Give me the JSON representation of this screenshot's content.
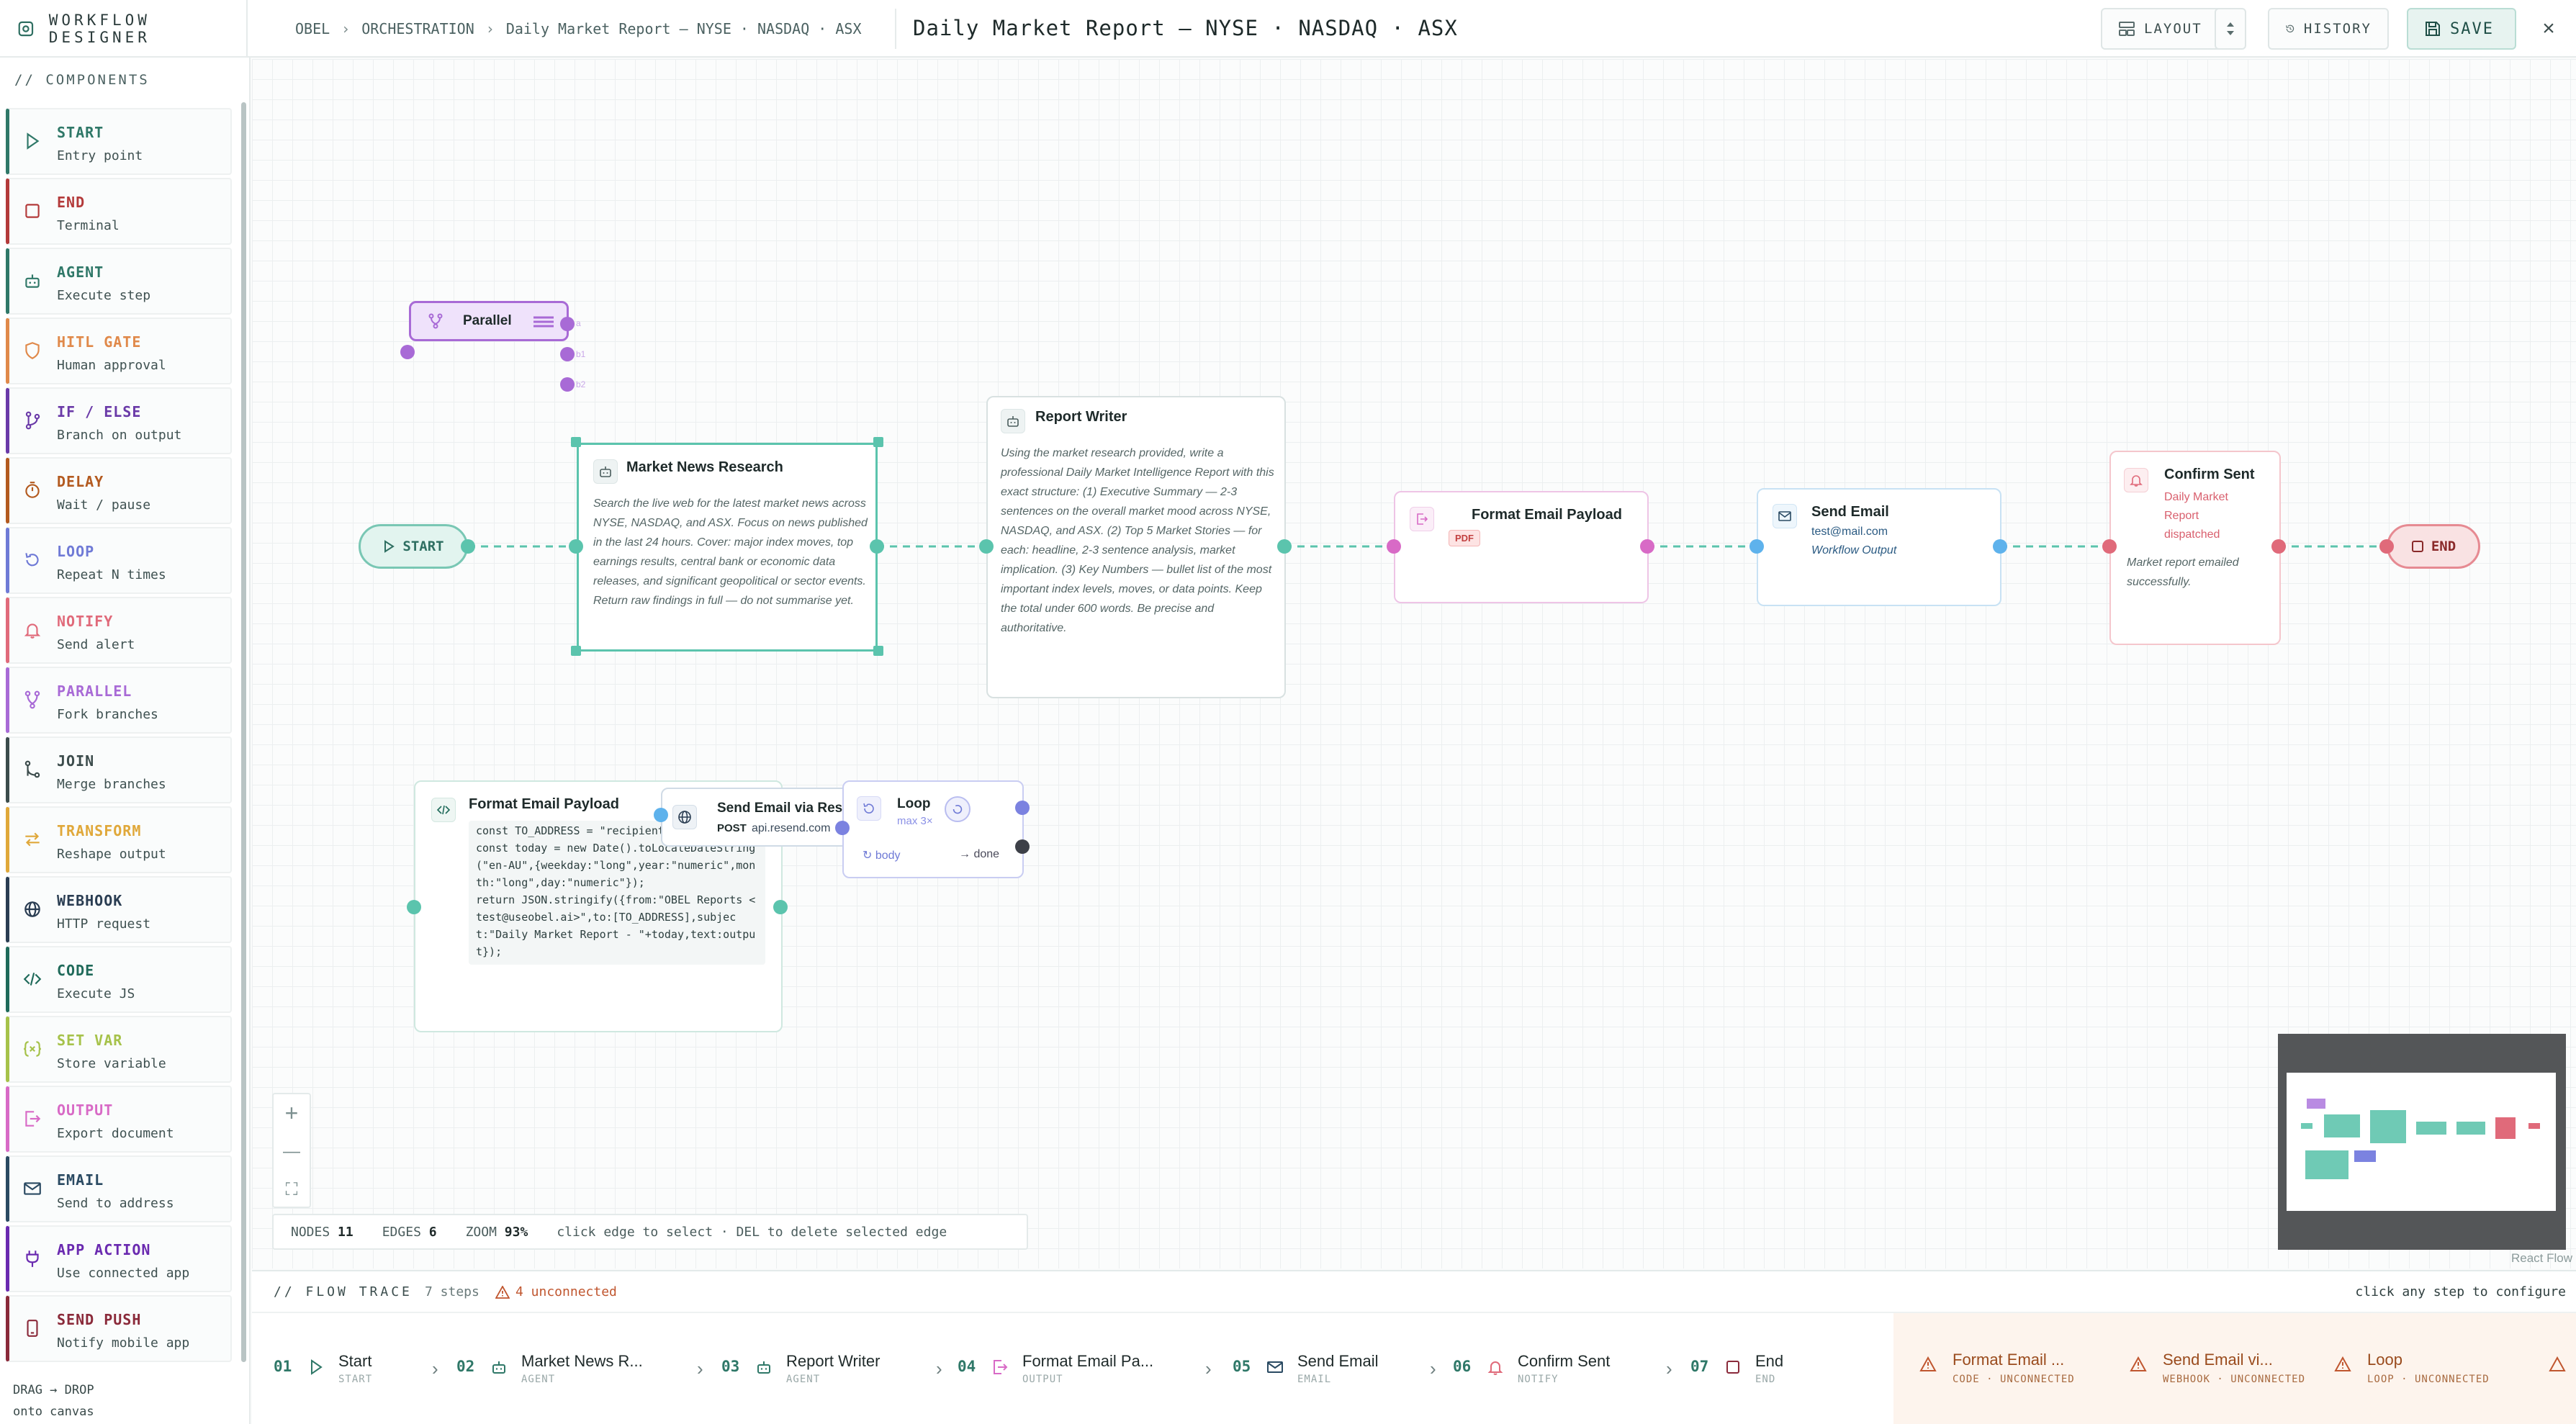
{
  "header": {
    "brand": "WORKFLOW DESIGNER",
    "breadcrumb": [
      "OBEL",
      "ORCHESTRATION",
      "Daily Market Report — NYSE · NASDAQ · ASX"
    ],
    "title": "Daily Market Report — NYSE · NASDAQ · ASX",
    "layout_label": "LAYOUT",
    "history_label": "HISTORY",
    "save_label": "SAVE",
    "close_glyph": "×"
  },
  "sidebar": {
    "title": "// COMPONENTS",
    "items": [
      {
        "name": "START",
        "desc": "Entry point",
        "color": "#2f7868",
        "icon": "play-icon"
      },
      {
        "name": "END",
        "desc": "Terminal",
        "color": "#b33a3a",
        "icon": "stop-icon"
      },
      {
        "name": "AGENT",
        "desc": "Execute step",
        "color": "#2f7868",
        "icon": "bot-icon"
      },
      {
        "name": "HITL GATE",
        "desc": "Human approval",
        "color": "#e0894a",
        "icon": "shield-icon"
      },
      {
        "name": "IF / ELSE",
        "desc": "Branch on output",
        "color": "#6a3aa8",
        "icon": "branch-icon"
      },
      {
        "name": "DELAY",
        "desc": "Wait / pause",
        "color": "#b35a1f",
        "icon": "timer-icon"
      },
      {
        "name": "LOOP",
        "desc": "Repeat N times",
        "color": "#6f7ad6",
        "icon": "loop-icon"
      },
      {
        "name": "NOTIFY",
        "desc": "Send alert",
        "color": "#e06a7a",
        "icon": "bell-icon"
      },
      {
        "name": "PARALLEL",
        "desc": "Fork branches",
        "color": "#a86ad6",
        "icon": "fork-icon"
      },
      {
        "name": "JOIN",
        "desc": "Merge branches",
        "color": "#3c4c4c",
        "icon": "merge-icon"
      },
      {
        "name": "TRANSFORM",
        "desc": "Reshape output",
        "color": "#e0a83a",
        "icon": "transform-icon"
      },
      {
        "name": "WEBHOOK",
        "desc": "HTTP request",
        "color": "#2a3d52",
        "icon": "globe-icon"
      },
      {
        "name": "CODE",
        "desc": "Execute JS",
        "color": "#1f6a5a",
        "icon": "code-icon"
      },
      {
        "name": "SET VAR",
        "desc": "Store variable",
        "color": "#a6c24a",
        "icon": "variable-icon"
      },
      {
        "name": "OUTPUT",
        "desc": "Export document",
        "color": "#d86ac6",
        "icon": "output-icon"
      },
      {
        "name": "EMAIL",
        "desc": "Send to address",
        "color": "#2a4a62",
        "icon": "mail-icon"
      },
      {
        "name": "APP ACTION",
        "desc": "Use connected app",
        "color": "#6a2ab0",
        "icon": "plug-icon"
      },
      {
        "name": "SEND PUSH",
        "desc": "Notify mobile app",
        "color": "#8a2a3a",
        "icon": "phone-icon"
      }
    ],
    "hint_line1": "DRAG → DROP",
    "hint_line2": "onto canvas"
  },
  "canvas": {
    "parallel": {
      "label": "Parallel",
      "ports": [
        "a",
        "b1",
        "b2"
      ]
    },
    "start": {
      "label": "START"
    },
    "end": {
      "label": "END"
    },
    "market_research": {
      "title": "Market News Research",
      "body": "Search the live web for the latest market news across NYSE, NASDAQ, and ASX. Focus on news published in the last 24 hours. Cover: major index moves, top earnings results, central bank or economic data releases, and significant geopolitical or sector events. Return raw findings in full — do not summarise yet."
    },
    "report_writer": {
      "title": "Report Writer",
      "body": "Using the market research provided, write a professional Daily Market Intelligence Report with this exact structure: (1) Executive Summary — 2-3 sentences on the overall market mood across NYSE, NASDAQ, and ASX. (2) Top 5 Market Stories — for each: headline, 2-3 sentence analysis, market implication. (3) Key Numbers — bullet list of the most important index levels, moves, or data points. Keep the total under 600 words. Be precise and authoritative."
    },
    "format_email": {
      "title": "Format Email Payload",
      "badge": "PDF"
    },
    "send_email": {
      "title": "Send Email",
      "address": "test@mail.com",
      "sub": "Workflow Output"
    },
    "confirm_sent": {
      "title": "Confirm Sent",
      "detail": "Daily Market Report dispatched",
      "body": "Market report emailed successfully."
    },
    "code_node": {
      "title": "Format Email Payload",
      "code": "const TO_ADDRESS = \"recipient\nconst today = new Date().toLocaleDateString\n(\"en-AU\",{weekday:\"long\",year:\"numeric\",mon\nth:\"long\",day:\"numeric\"});\nreturn JSON.stringify({from:\"OBEL Reports <\ntest@useobel.ai>\",to:[TO_ADDRESS],subjec\nt:\"Daily Market Report - \"+today,text:outpu\nt});"
    },
    "webhook_node": {
      "title": "Send Email via Rese",
      "method": "POST",
      "url": "api.resend.com"
    },
    "loop_node": {
      "title": "Loop",
      "max": "max 3×",
      "body_label": "↻ body",
      "done_label": "→ done"
    },
    "zoom_in": "+",
    "zoom_out": "—",
    "fit": "⛶",
    "status": {
      "nodes_label": "NODES",
      "nodes": "11",
      "edges_label": "EDGES",
      "edges": "6",
      "zoom_label": "ZOOM",
      "zoom": "93%",
      "hint": "click edge to select · DEL to delete selected edge"
    },
    "attribution": "React Flow"
  },
  "trace": {
    "title": "// FLOW TRACE",
    "steps_count": "7 steps",
    "unconnected_count": "4 unconnected",
    "hint": "click any step to configure",
    "steps": [
      {
        "num": "01",
        "label": "Start",
        "type": "START",
        "icon": "play-icon"
      },
      {
        "num": "02",
        "label": "Market News R...",
        "type": "AGENT",
        "icon": "bot-icon"
      },
      {
        "num": "03",
        "label": "Report Writer",
        "type": "AGENT",
        "icon": "bot-icon"
      },
      {
        "num": "04",
        "label": "Format Email Pa...",
        "type": "OUTPUT",
        "icon": "output-icon"
      },
      {
        "num": "05",
        "label": "Send Email",
        "type": "EMAIL",
        "icon": "mail-icon"
      },
      {
        "num": "06",
        "label": "Confirm Sent",
        "type": "NOTIFY",
        "icon": "bell-icon"
      },
      {
        "num": "07",
        "label": "End",
        "type": "END",
        "icon": "stop-icon"
      }
    ],
    "unconnected": [
      {
        "label": "Format Email ...",
        "type": "CODE · UNCONNECTED"
      },
      {
        "label": "Send Email vi...",
        "type": "WEBHOOK · UNCONNECTED"
      },
      {
        "label": "Loop",
        "type": "LOOP · UNCONNECTED"
      }
    ]
  },
  "colors": {
    "accent": "#5bc4ad",
    "email": "#5eb2ec",
    "output": "#d86ac6",
    "notify": "#e06a7a",
    "parallel": "#a86ad6",
    "loop": "#7b82e0"
  }
}
